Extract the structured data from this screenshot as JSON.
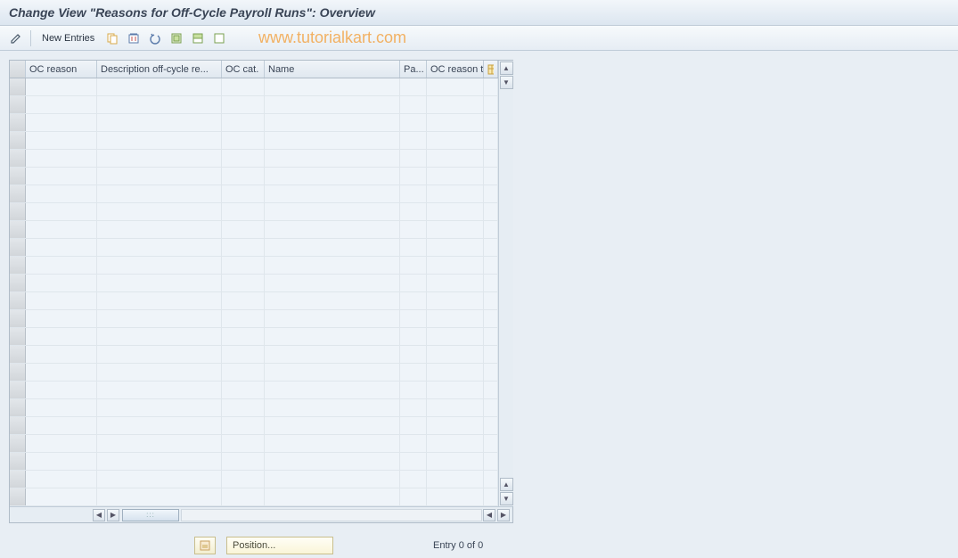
{
  "title": "Change View \"Reasons for Off-Cycle Payroll Runs\": Overview",
  "toolbar": {
    "new_entries_label": "New Entries"
  },
  "watermark": "www.tutorialkart.com",
  "table": {
    "columns": [
      "OC reason",
      "Description off-cycle re...",
      "OC cat.",
      "Name",
      "Pa...",
      "OC reason t"
    ],
    "row_count": 24
  },
  "footer": {
    "position_label": "Position...",
    "entry_label": "Entry 0 of 0"
  },
  "icons": {
    "edit": "edit-icon",
    "copy": "copy-icon",
    "save": "save-icon",
    "undo": "undo-icon",
    "select_all": "select-all-icon",
    "deselect_all": "deselect-all-icon",
    "config": "config-icon",
    "table_settings": "table-settings-icon"
  }
}
